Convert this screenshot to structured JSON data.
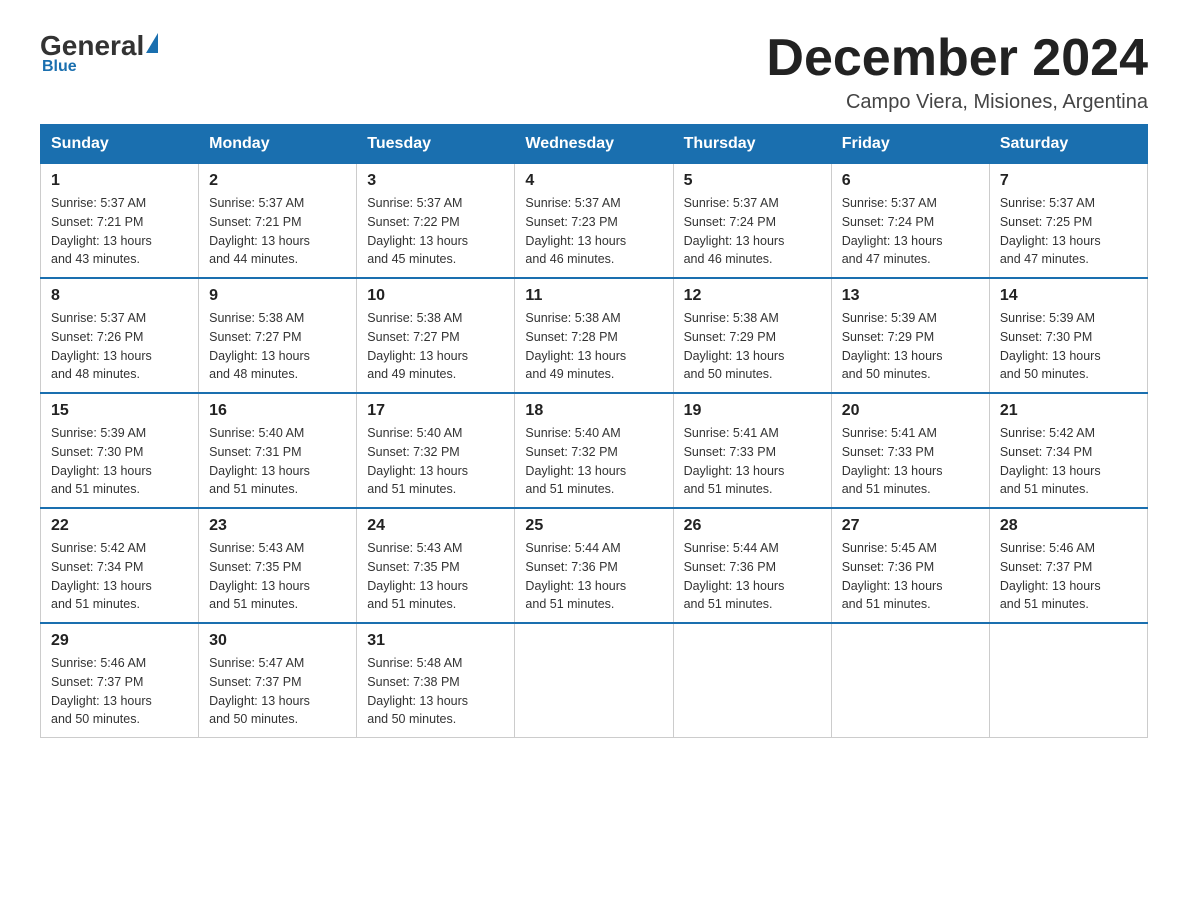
{
  "logo": {
    "general": "General",
    "blue": "Blue",
    "tagline": "Blue"
  },
  "title": "December 2024",
  "subtitle": "Campo Viera, Misiones, Argentina",
  "days_header": [
    "Sunday",
    "Monday",
    "Tuesday",
    "Wednesday",
    "Thursday",
    "Friday",
    "Saturday"
  ],
  "weeks": [
    [
      {
        "day": "1",
        "sunrise": "5:37 AM",
        "sunset": "7:21 PM",
        "daylight": "13 hours and 43 minutes."
      },
      {
        "day": "2",
        "sunrise": "5:37 AM",
        "sunset": "7:21 PM",
        "daylight": "13 hours and 44 minutes."
      },
      {
        "day": "3",
        "sunrise": "5:37 AM",
        "sunset": "7:22 PM",
        "daylight": "13 hours and 45 minutes."
      },
      {
        "day": "4",
        "sunrise": "5:37 AM",
        "sunset": "7:23 PM",
        "daylight": "13 hours and 46 minutes."
      },
      {
        "day": "5",
        "sunrise": "5:37 AM",
        "sunset": "7:24 PM",
        "daylight": "13 hours and 46 minutes."
      },
      {
        "day": "6",
        "sunrise": "5:37 AM",
        "sunset": "7:24 PM",
        "daylight": "13 hours and 47 minutes."
      },
      {
        "day": "7",
        "sunrise": "5:37 AM",
        "sunset": "7:25 PM",
        "daylight": "13 hours and 47 minutes."
      }
    ],
    [
      {
        "day": "8",
        "sunrise": "5:37 AM",
        "sunset": "7:26 PM",
        "daylight": "13 hours and 48 minutes."
      },
      {
        "day": "9",
        "sunrise": "5:38 AM",
        "sunset": "7:27 PM",
        "daylight": "13 hours and 48 minutes."
      },
      {
        "day": "10",
        "sunrise": "5:38 AM",
        "sunset": "7:27 PM",
        "daylight": "13 hours and 49 minutes."
      },
      {
        "day": "11",
        "sunrise": "5:38 AM",
        "sunset": "7:28 PM",
        "daylight": "13 hours and 49 minutes."
      },
      {
        "day": "12",
        "sunrise": "5:38 AM",
        "sunset": "7:29 PM",
        "daylight": "13 hours and 50 minutes."
      },
      {
        "day": "13",
        "sunrise": "5:39 AM",
        "sunset": "7:29 PM",
        "daylight": "13 hours and 50 minutes."
      },
      {
        "day": "14",
        "sunrise": "5:39 AM",
        "sunset": "7:30 PM",
        "daylight": "13 hours and 50 minutes."
      }
    ],
    [
      {
        "day": "15",
        "sunrise": "5:39 AM",
        "sunset": "7:30 PM",
        "daylight": "13 hours and 51 minutes."
      },
      {
        "day": "16",
        "sunrise": "5:40 AM",
        "sunset": "7:31 PM",
        "daylight": "13 hours and 51 minutes."
      },
      {
        "day": "17",
        "sunrise": "5:40 AM",
        "sunset": "7:32 PM",
        "daylight": "13 hours and 51 minutes."
      },
      {
        "day": "18",
        "sunrise": "5:40 AM",
        "sunset": "7:32 PM",
        "daylight": "13 hours and 51 minutes."
      },
      {
        "day": "19",
        "sunrise": "5:41 AM",
        "sunset": "7:33 PM",
        "daylight": "13 hours and 51 minutes."
      },
      {
        "day": "20",
        "sunrise": "5:41 AM",
        "sunset": "7:33 PM",
        "daylight": "13 hours and 51 minutes."
      },
      {
        "day": "21",
        "sunrise": "5:42 AM",
        "sunset": "7:34 PM",
        "daylight": "13 hours and 51 minutes."
      }
    ],
    [
      {
        "day": "22",
        "sunrise": "5:42 AM",
        "sunset": "7:34 PM",
        "daylight": "13 hours and 51 minutes."
      },
      {
        "day": "23",
        "sunrise": "5:43 AM",
        "sunset": "7:35 PM",
        "daylight": "13 hours and 51 minutes."
      },
      {
        "day": "24",
        "sunrise": "5:43 AM",
        "sunset": "7:35 PM",
        "daylight": "13 hours and 51 minutes."
      },
      {
        "day": "25",
        "sunrise": "5:44 AM",
        "sunset": "7:36 PM",
        "daylight": "13 hours and 51 minutes."
      },
      {
        "day": "26",
        "sunrise": "5:44 AM",
        "sunset": "7:36 PM",
        "daylight": "13 hours and 51 minutes."
      },
      {
        "day": "27",
        "sunrise": "5:45 AM",
        "sunset": "7:36 PM",
        "daylight": "13 hours and 51 minutes."
      },
      {
        "day": "28",
        "sunrise": "5:46 AM",
        "sunset": "7:37 PM",
        "daylight": "13 hours and 51 minutes."
      }
    ],
    [
      {
        "day": "29",
        "sunrise": "5:46 AM",
        "sunset": "7:37 PM",
        "daylight": "13 hours and 50 minutes."
      },
      {
        "day": "30",
        "sunrise": "5:47 AM",
        "sunset": "7:37 PM",
        "daylight": "13 hours and 50 minutes."
      },
      {
        "day": "31",
        "sunrise": "5:48 AM",
        "sunset": "7:38 PM",
        "daylight": "13 hours and 50 minutes."
      },
      null,
      null,
      null,
      null
    ]
  ],
  "labels": {
    "sunrise": "Sunrise:",
    "sunset": "Sunset:",
    "daylight": "Daylight:"
  }
}
